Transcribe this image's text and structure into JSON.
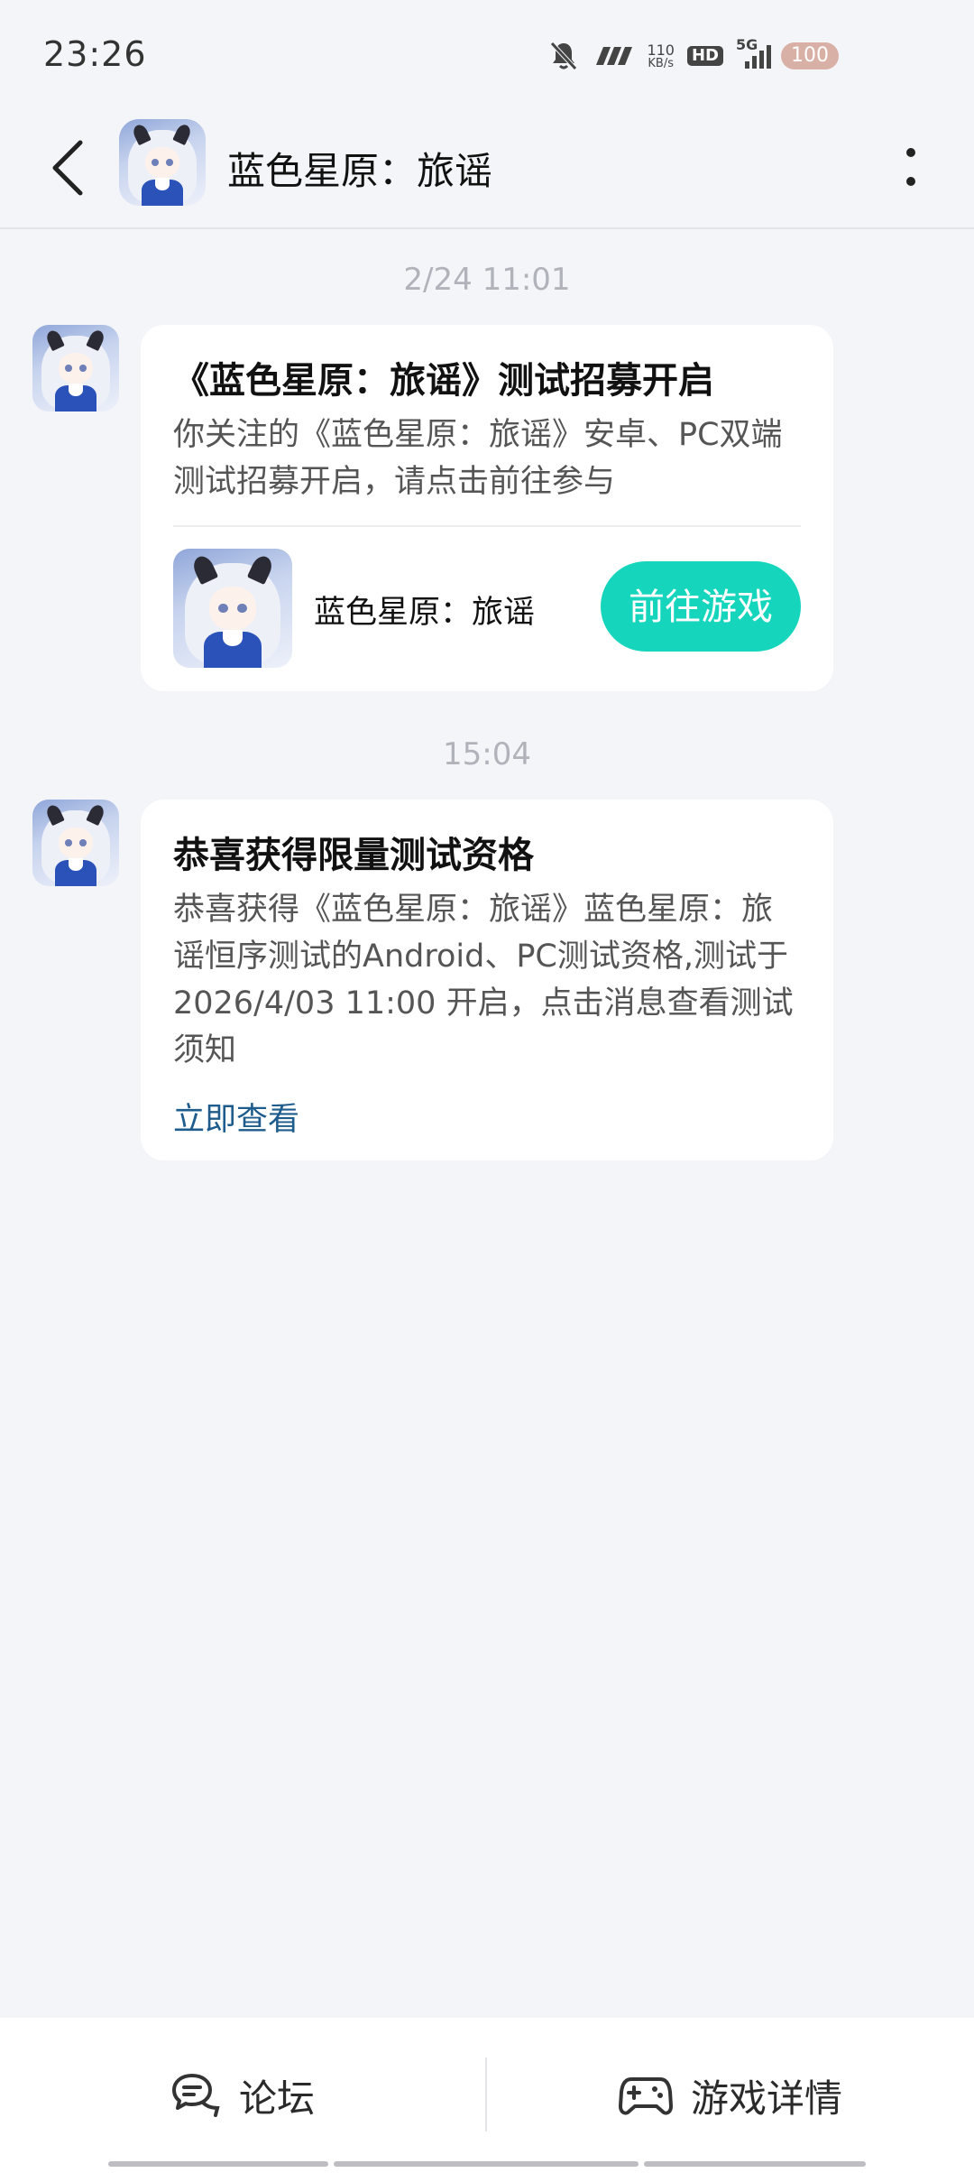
{
  "status_bar": {
    "time": "23:26",
    "net_speed_value": "110",
    "net_speed_unit": "KB/s",
    "hd_label": "HD",
    "network_label": "5G",
    "battery": "100",
    "icons": [
      "mute-bell-icon",
      "signal-hd-icon",
      "cellular-signal-icon",
      "wifi-icon",
      "battery-icon"
    ]
  },
  "header": {
    "title": "蓝色星原：旅谣",
    "back_icon": "chevron-left-icon",
    "more_icon": "more-vertical-icon"
  },
  "messages": [
    {
      "timestamp": "2/24  11:01",
      "title": "《蓝色星原：旅谣》测试招募开启",
      "body": "你关注的《蓝色星原：旅谣》安卓、PC双端测试招募开启，请点击前往参与",
      "game_name": "蓝色星原：旅谣",
      "button_label": "前往游戏"
    },
    {
      "timestamp": "15:04",
      "title": "恭喜获得限量测试资格",
      "body": "恭喜获得《蓝色星原：旅谣》蓝色星原：旅谣恒序测试的Android、PC测试资格,测试于2026/4/03 11:00 开启，点击消息查看测试须知",
      "link_label": "立即查看"
    }
  ],
  "bottom_bar": {
    "forum_label": "论坛",
    "game_detail_label": "游戏详情"
  },
  "colors": {
    "accent": "#15d6bd",
    "link": "#1d5c8c",
    "background": "#f4f5f9"
  }
}
